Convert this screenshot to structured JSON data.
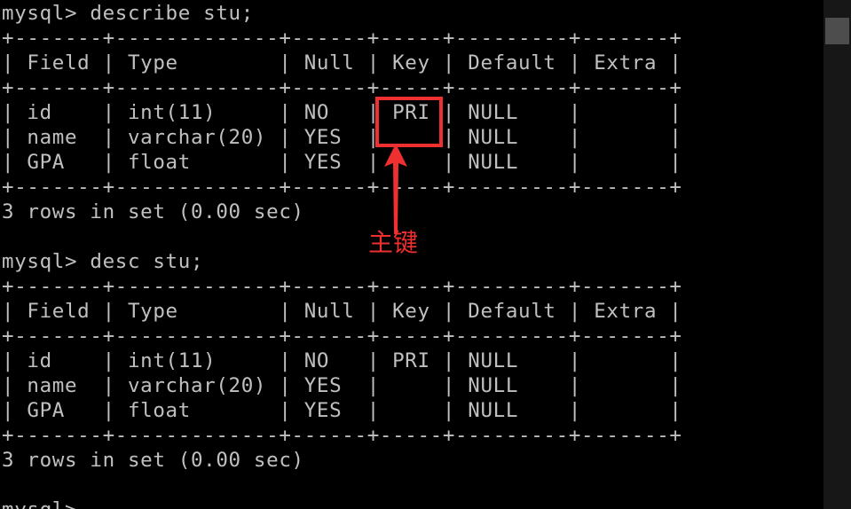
{
  "terminal": {
    "lines": [
      "mysql> describe stu;",
      "+-------+-------------+------+-----+---------+-------+",
      "| Field | Type        | Null | Key | Default | Extra |",
      "+-------+-------------+------+-----+---------+-------+",
      "| id    | int(11)     | NO   | PRI | NULL    |       |",
      "| name  | varchar(20) | YES  |     | NULL    |       |",
      "| GPA   | float       | YES  |     | NULL    |       |",
      "+-------+-------------+------+-----+---------+-------+",
      "3 rows in set (0.00 sec)",
      "",
      "mysql> desc stu;",
      "+-------+-------------+------+-----+---------+-------+",
      "| Field | Type        | Null | Key | Default | Extra |",
      "+-------+-------------+------+-----+---------+-------+",
      "| id    | int(11)     | NO   | PRI | NULL    |       |",
      "| name  | varchar(20) | YES  |     | NULL    |       |",
      "| GPA   | float       | YES  |     | NULL    |       |",
      "+-------+-------------+------+-----+---------+-------+",
      "3 rows in set (0.00 sec)",
      "",
      "mysql> "
    ]
  },
  "annotation": {
    "label": "主键"
  },
  "colors": {
    "background": "#000000",
    "terminal_text": "#c0c0c0",
    "annotation": "#ee3030",
    "scrollbar_track": "#171717",
    "scrollbar_thumb": "#4d4d4d"
  }
}
